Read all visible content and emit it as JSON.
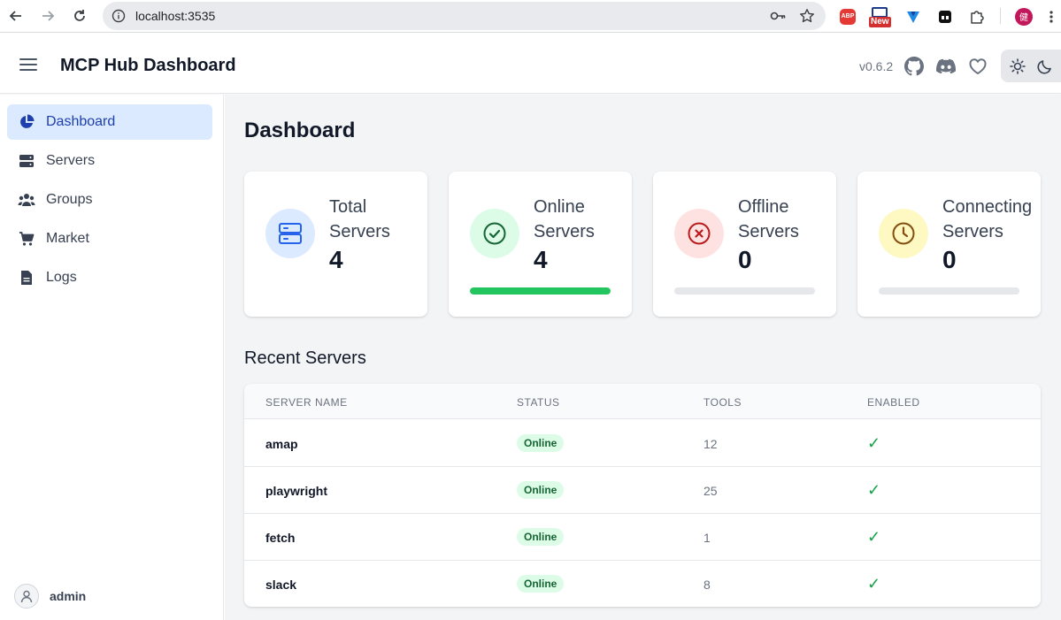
{
  "browser": {
    "url": "localhost:3535",
    "extensions": {
      "abp_label": "ABP",
      "new_label": "New",
      "avatar_letter": "健"
    }
  },
  "header": {
    "title": "MCP Hub Dashboard",
    "version": "v0.6.2"
  },
  "sidebar": {
    "items": [
      {
        "label": "Dashboard",
        "icon": "pie-chart-icon",
        "active": true
      },
      {
        "label": "Servers",
        "icon": "server-icon"
      },
      {
        "label": "Groups",
        "icon": "users-icon"
      },
      {
        "label": "Market",
        "icon": "cart-icon"
      },
      {
        "label": "Logs",
        "icon": "document-icon"
      }
    ],
    "user": "admin"
  },
  "main": {
    "title": "Dashboard",
    "cards": [
      {
        "label": "Total Servers",
        "value": "4",
        "icon": "server-icon",
        "color": "#2563eb"
      },
      {
        "label": "Online Servers",
        "value": "4",
        "icon": "check-circle-icon",
        "color": "#16a34a",
        "progress": 1.0
      },
      {
        "label": "Offline Servers",
        "value": "0",
        "icon": "x-circle-icon",
        "color": "#dc2626",
        "progress": 0.0
      },
      {
        "label": "Connecting Servers",
        "value": "0",
        "icon": "clock-icon",
        "color": "#ca8a04",
        "progress": 0.0
      }
    ],
    "recent_title": "Recent Servers",
    "table": {
      "headers": [
        "SERVER NAME",
        "STATUS",
        "TOOLS",
        "ENABLED"
      ],
      "rows": [
        {
          "name": "amap",
          "status": "Online",
          "tools": "12",
          "enabled": "✓"
        },
        {
          "name": "playwright",
          "status": "Online",
          "tools": "25",
          "enabled": "✓"
        },
        {
          "name": "fetch",
          "status": "Online",
          "tools": "1",
          "enabled": "✓"
        },
        {
          "name": "slack",
          "status": "Online",
          "tools": "8",
          "enabled": "✓"
        }
      ]
    }
  }
}
